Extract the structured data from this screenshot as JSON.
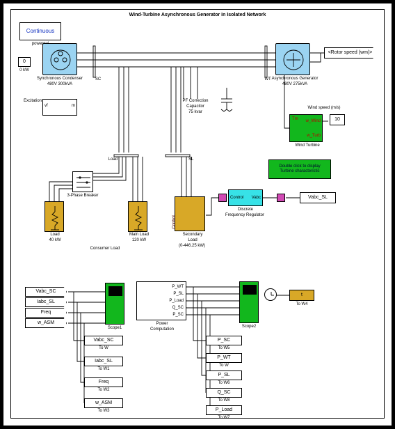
{
  "title": "Wind-Turbine Asynchronous Generator in Isolated Network",
  "powergui": {
    "label": "Continuous",
    "caption": "powergui"
  },
  "const0": {
    "value": "0",
    "caption": "0 kW"
  },
  "sync_condenser": {
    "label": "Synchronous Condenser",
    "rating": "480V 300kVA"
  },
  "excitation_label": "Excitation",
  "bus_SC": "SC",
  "bus_WT": "WT",
  "pf_cap": {
    "label1": "PF Correction",
    "label2": "Capacitor",
    "label3": "75 kvar"
  },
  "async_gen": {
    "label": "Asynchronous Generator",
    "rating": "480V 275kVA"
  },
  "rotor_speed_tag": "<Rotor speed (wm)>",
  "wind_turbine": {
    "label": "Wind Turbine",
    "in1": "w_Wind",
    "in2": "w_Turb",
    "out": "Tm"
  },
  "wind_speed": {
    "label": "Wind speed (m/s)",
    "value": "10"
  },
  "turbine_char": {
    "line1": "Double click to display",
    "line2": "Turbine characteristic"
  },
  "bus_Load": "Load",
  "bus_SL": "SL",
  "breaker": "3-Phase Breaker",
  "load1": {
    "label1": "Load",
    "label2": "40 kW"
  },
  "main_load": {
    "label1": "Main Load",
    "label2": "120 kW"
  },
  "consumer": "Consumer Load",
  "secondary_load": {
    "label1": "Secondary",
    "label2": "Load",
    "label3": "(0-446.25 kW)"
  },
  "freq_reg": {
    "label": "Discrete",
    "label2": "Frequency Regulator",
    "pin1": "Control",
    "pin2": "Vabc"
  },
  "vabc_sl_tag": "Vabc_SL",
  "scope1": "Scope1",
  "pow_comp": {
    "label1": "Power",
    "label2": "Computation",
    "p1": "P_WT",
    "p2": "P_SL",
    "p3": "P_Load",
    "p4": "Q_SC",
    "p5": "P_SC"
  },
  "scope2": "Scope2",
  "clock_tag": "t",
  "to_w4": "To W4",
  "from_tags": {
    "vabc_sc": "Vabc_SC",
    "iabc_sl": "Iabc_SL",
    "freq": "Freq",
    "w_asm": "w_ASM"
  },
  "tow_left": {
    "b0": "Vabc_SC",
    "t0": "To W",
    "b1": "Iabc_SL",
    "t1": "To W1",
    "b2": "Freq",
    "t2": "To W2",
    "b3": "w_ASM",
    "t3": "To W3"
  },
  "tow_right": {
    "b0": "P_SC",
    "t0": "To W5",
    "b1": "P_WT",
    "t1": "To W",
    "b2": "P_SL",
    "t2": "To W6",
    "b3": "Q_SC",
    "t3": "To W8",
    "b4": "P_Load",
    "t4": "To W7"
  },
  "chart_data": {
    "type": "block_diagram",
    "tool": "Simulink",
    "blocks": [
      {
        "id": "powergui",
        "type": "powergui",
        "mode": "Continuous"
      },
      {
        "id": "const_0kW",
        "type": "Constant",
        "value": 0,
        "unit": "kW"
      },
      {
        "id": "sync_condenser",
        "type": "SynchronousMachine",
        "V": 480,
        "S_kVA": 300
      },
      {
        "id": "excitation",
        "type": "Excitation"
      },
      {
        "id": "bus_SC",
        "type": "Bus",
        "name": "SC"
      },
      {
        "id": "bus_WT",
        "type": "Bus",
        "name": "WT"
      },
      {
        "id": "PF_capacitor",
        "type": "Capacitor",
        "kvar": 75,
        "note": "PF Correction"
      },
      {
        "id": "async_generator",
        "type": "AsynchronousMachine",
        "V": 480,
        "S_kVA": 275
      },
      {
        "id": "wind_turbine",
        "type": "WindTurbine",
        "inputs": [
          "wind_speed",
          "rotor_speed"
        ],
        "output": "Tm"
      },
      {
        "id": "wind_speed_const",
        "type": "Constant",
        "value": 10,
        "unit": "m/s"
      },
      {
        "id": "turbine_char_display",
        "type": "Annotation",
        "text": "Double click to display Turbine characteristic"
      },
      {
        "id": "bus_Load",
        "type": "Bus",
        "name": "Load"
      },
      {
        "id": "bus_SL",
        "type": "Bus",
        "name": "SL"
      },
      {
        "id": "breaker_3ph",
        "type": "ThreePhaseBreaker"
      },
      {
        "id": "load_40kW",
        "type": "RLCLoad",
        "P_kW": 40
      },
      {
        "id": "main_load_120kW",
        "type": "RLCLoad",
        "P_kW": 120
      },
      {
        "id": "secondary_load",
        "type": "VariableLoad",
        "P_range_kW": [
          0,
          446.25
        ]
      },
      {
        "id": "freq_regulator",
        "type": "DiscreteFrequencyRegulator",
        "in": "Vabc",
        "out": "Control"
      },
      {
        "id": "scope1",
        "type": "Scope",
        "signals": [
          "Vabc_SC",
          "Iabc_SL",
          "Freq",
          "w_ASM"
        ]
      },
      {
        "id": "power_computation",
        "type": "Subsystem",
        "outputs": [
          "P_WT",
          "P_SL",
          "P_Load",
          "Q_SC",
          "P_SC"
        ]
      },
      {
        "id": "scope2",
        "type": "Scope",
        "signals": [
          "P_WT",
          "P_SL",
          "P_Load",
          "Q_SC",
          "P_SC"
        ]
      },
      {
        "id": "clock",
        "type": "Clock"
      },
      {
        "id": "to_workspace",
        "names": [
          "t",
          "Vabc_SC",
          "Iabc_SL",
          "Freq",
          "w_ASM",
          "P_SC",
          "P_WT",
          "P_SL",
          "Q_SC",
          "P_Load"
        ]
      }
    ],
    "connections_summary": "SC bus ↔ PF Capacitor ↔ WT bus ↔ Async Gen. SC bus → Load bus → SL bus → Secondary Load / Freq Regulator. Load bus → Main Load & 3-Ph Breaker → Load 40kW. Wind Turbine drives Tm of Async Gen. Signals routed to Scopes and ToWorkspace."
  }
}
